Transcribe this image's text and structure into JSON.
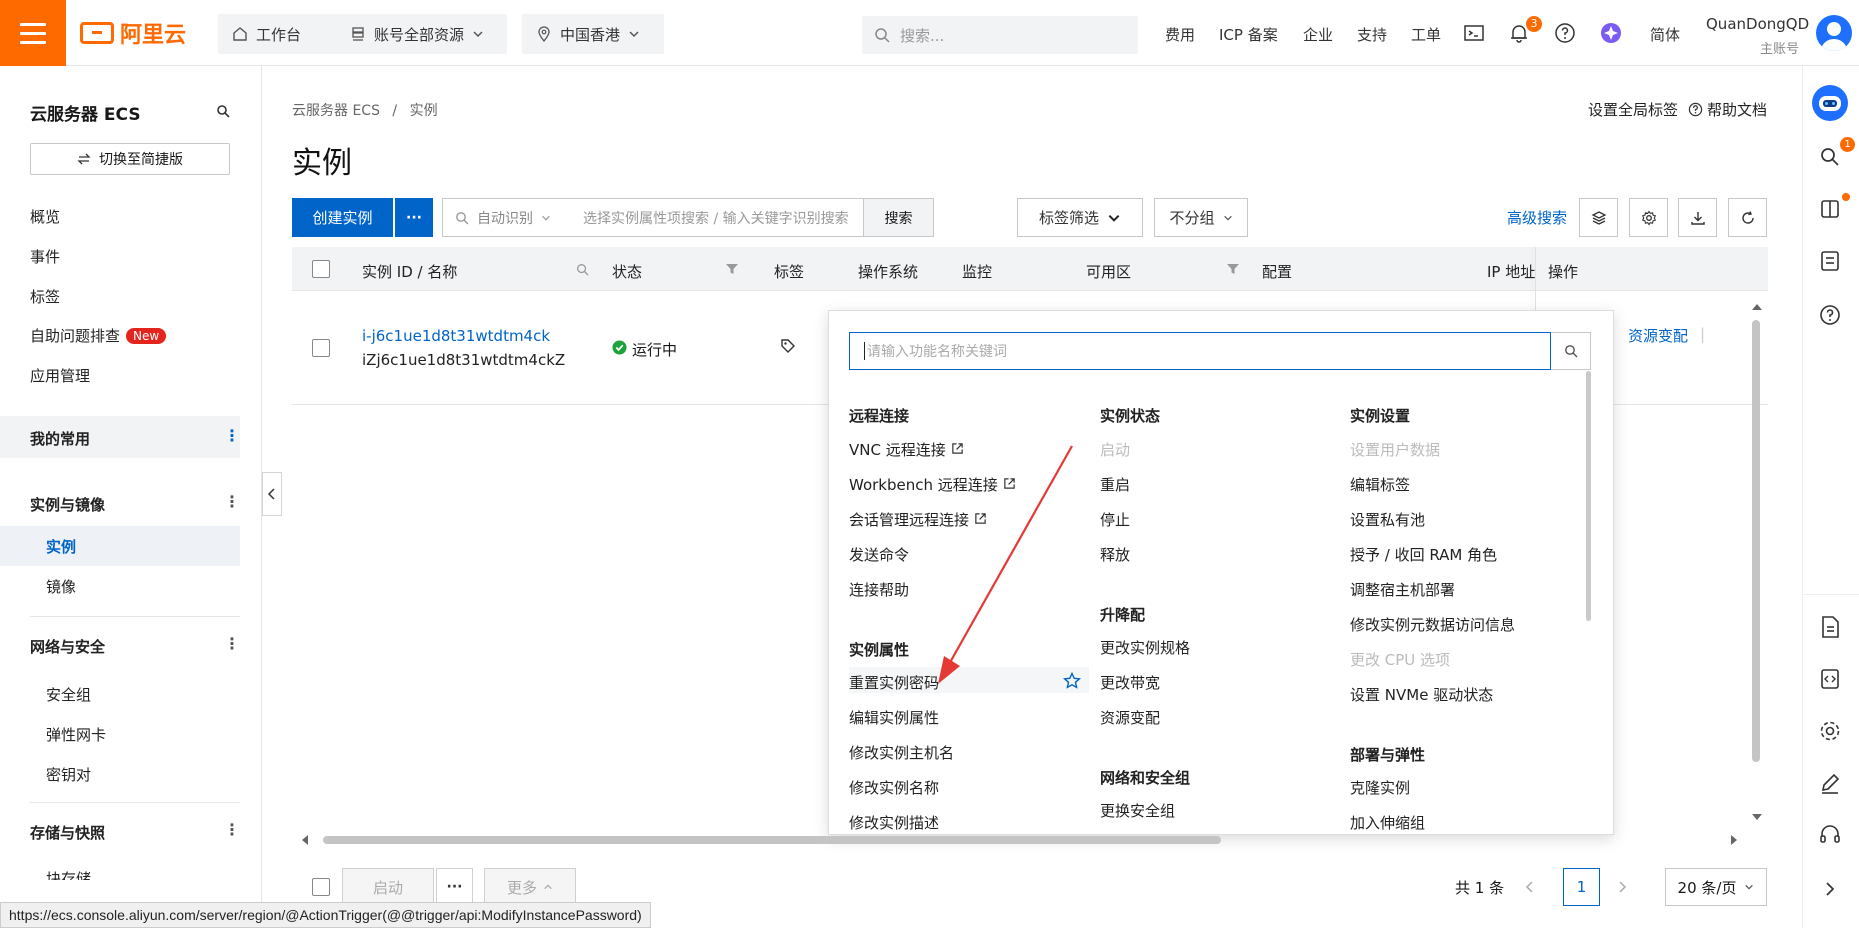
{
  "topbar": {
    "logo_text": "阿里云",
    "workbench": "工作台",
    "resources": "账号全部资源",
    "region": "中国香港",
    "search_placeholder": "搜索...",
    "links": [
      "费用",
      "ICP 备案",
      "企业",
      "支持",
      "工单"
    ],
    "notif_count": "3",
    "lang": "简体",
    "user_name": "QuanDongQD",
    "user_role": "主账号",
    "brand_color": "#ff6a00"
  },
  "sidebar": {
    "title": "云服务器 ECS",
    "switch_label": "切换至简捷版",
    "items": [
      "概览",
      "事件",
      "标签",
      "自助问题排查",
      "应用管理"
    ],
    "new_badge": "New",
    "my_common": "我的常用",
    "group_instance": "实例与镜像",
    "instance": "实例",
    "image": "镜像",
    "group_network": "网络与安全",
    "security_group": "安全组",
    "eni": "弹性网卡",
    "keypair": "密钥对",
    "group_storage": "存储与快照",
    "block_storage": "块存储"
  },
  "main": {
    "breadcrumb_root": "云服务器 ECS",
    "breadcrumb_sep": "/",
    "breadcrumb_current": "实例",
    "title": "实例",
    "global_tag": "设置全局标签",
    "help_doc": "帮助文档",
    "create_btn": "创建实例",
    "search_type": "自动识别",
    "search_placeholder": "选择实例属性项搜索 / 输入关键字识别搜索",
    "search_btn": "搜索",
    "tag_filter": "标签筛选",
    "no_group": "不分组",
    "adv_search": "高级搜索",
    "accent": "#0064c8"
  },
  "table": {
    "headers": [
      "实例 ID / 名称",
      "状态",
      "标签",
      "操作系统",
      "监控",
      "可用区",
      "配置",
      "IP 地址",
      "操作"
    ],
    "row": {
      "id": "i-j6c1ue1d8t31wtdtm4ck",
      "name": "iZj6c1ue1d8t31wtdtm4ckZ",
      "status": "运行中",
      "op_link": "资源变配"
    }
  },
  "panel": {
    "placeholder": "请输入功能名称关键词",
    "col1": {
      "head1": "远程连接",
      "items1": [
        "VNC 远程连接",
        "Workbench 远程连接",
        "会话管理远程连接",
        "发送命令",
        "连接帮助"
      ],
      "head2": "实例属性",
      "items2": [
        "重置实例密码",
        "编辑实例属性",
        "修改实例主机名",
        "修改实例名称",
        "修改实例描述"
      ]
    },
    "col2": {
      "head1": "实例状态",
      "items1": [
        "启动",
        "重启",
        "停止",
        "释放"
      ],
      "head2": "升降配",
      "items2": [
        "更改实例规格",
        "更改带宽",
        "资源变配"
      ],
      "head3": "网络和安全组",
      "items3": [
        "更换安全组"
      ]
    },
    "col3": {
      "head1": "实例设置",
      "items1": [
        "设置用户数据",
        "编辑标签",
        "设置私有池",
        "授予 / 收回 RAM 角色",
        "调整宿主机部署",
        "修改实例元数据访问信息",
        "更改 CPU 选项",
        "设置 NVMe 驱动状态"
      ],
      "head2": "部署与弹性",
      "items2": [
        "克隆实例",
        "加入伸缩组"
      ]
    }
  },
  "footer": {
    "start": "启动",
    "more": "更多",
    "total": "共 1 条",
    "page": "1",
    "page_size": "20 条/页"
  },
  "status_bar_url": "https://ecs.console.aliyun.com/server/region/@ActionTrigger(@@trigger/api:ModifyInstancePassword)",
  "rail": {
    "notif_count": "1"
  }
}
